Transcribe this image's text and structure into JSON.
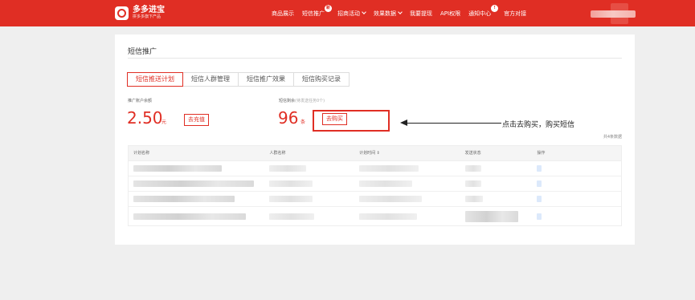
{
  "header": {
    "brand_name": "多多进宝",
    "brand_sub": "拼多多旗下产品",
    "nav": [
      {
        "label": "商品展示"
      },
      {
        "label": "短信推广",
        "badge": "新"
      },
      {
        "label": "招商活动",
        "dropdown": true
      },
      {
        "label": "效果数据",
        "dropdown": true
      },
      {
        "label": "我要提现"
      },
      {
        "label": "API权限"
      },
      {
        "label": "通知中心",
        "badge": "!"
      },
      {
        "label": "官方对接"
      }
    ],
    "accent_color": "#e02e24"
  },
  "page": {
    "title": "短信推广",
    "tabs": [
      {
        "label": "短信推送计划",
        "active": true
      },
      {
        "label": "短信人群管理"
      },
      {
        "label": "短信推广效果"
      },
      {
        "label": "短信购买记录"
      }
    ]
  },
  "stats": {
    "balance_label": "推广账户余额",
    "balance_value": "2.50",
    "balance_unit": "元",
    "recharge_button": "去充值",
    "sms_label": "短信剩余",
    "sms_label_note": "(待发送任务0个)",
    "sms_value": "96",
    "sms_unit": "条",
    "buy_button": "去购买"
  },
  "annotation": "点击去购买，购买短信",
  "table": {
    "total_text": "共4条数据",
    "columns": [
      "计划名称",
      "人群名称",
      "计划时间 ⇕",
      "发送状态",
      "操作"
    ]
  }
}
